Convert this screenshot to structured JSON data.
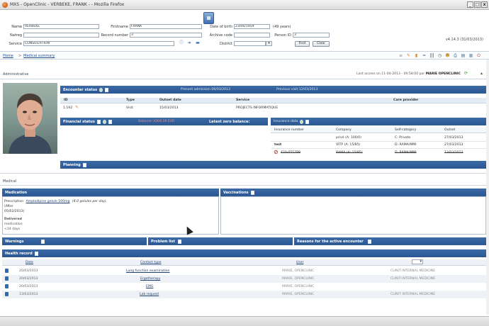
{
  "window": {
    "title": "MXS - OpenClinic - VERBEKE, FRANK - - Mozilla Firefox"
  },
  "patient": {
    "name_label": "Name",
    "name_value": "VERBEKE",
    "firstname_label": "Firstname",
    "firstname_value": "FRANK",
    "dob_label": "Date of birth",
    "dob_value": "23/06/1959",
    "age": "(49 years)",
    "natreg_label": "Natreg",
    "natreg_value": "",
    "record_label": "Record number",
    "record_value": "3",
    "archive_label": "Archive code",
    "archive_value": "",
    "person_label": "Person ID",
    "person_value": "3",
    "service_label": "Service",
    "service_value": "CONSULTATION",
    "district_label": "District",
    "district_value": ""
  },
  "buttons": {
    "find": "Find",
    "clear": "Clear"
  },
  "version": "v4.14.3 (31/03/2013)",
  "nav": {
    "home": "Home",
    "sep": ">",
    "summary": "Medical summary"
  },
  "administrative": {
    "title": "Administrative",
    "last_access_text": "Last access on 11-04-2013 - 09:58:00 par",
    "last_access_user": "MARIE OPENCLINIC"
  },
  "encounter": {
    "title": "Encounter status",
    "info_active": "Present admission 06/03/2013",
    "info_previous": "Previous visit 12/03/2013",
    "columns": [
      "ID",
      "Type",
      "Outset date",
      "Service",
      "Care provider"
    ],
    "rows": [
      {
        "id": "1.192",
        "type": "Visit",
        "date": "15/03/2013",
        "service": "PROJECTS INFORMATIQUE",
        "provider": ""
      }
    ]
  },
  "financial": {
    "title": "Financial status",
    "balance": "Balance: 4304,16 EUR",
    "last_zero": "Latest zero balance:"
  },
  "insurance": {
    "title": "Insurance data",
    "columns": [
      "Insurance number",
      "Company",
      "Self-category",
      "Outset"
    ],
    "rows": [
      {
        "number": "",
        "company": "privé (A: 100/0)",
        "category": "C: Privato",
        "outset": "27/03/2013"
      },
      {
        "number": "test",
        "company": "VITP (A: 15/85)",
        "category": "D: RAMA/MMI",
        "outset": "27/03/2013"
      },
      {
        "number": "420-055789",
        "company": "RAMA (A: 15/85)",
        "category": "D: RAMA/MMI",
        "outset": "13/03/2013"
      }
    ]
  },
  "planning": {
    "title": "Planning"
  },
  "medical": {
    "title": "Medical"
  },
  "medication": {
    "title": "Medication",
    "prescription_label": "Prescription",
    "drug": "Amplodipine gelule 500mg",
    "dosage": "(4.0 gelules per day)",
    "after_label": "(After",
    "after_date": "05/02/2013)",
    "delivered_label": "Delivered",
    "delivered_sub": "medication",
    "delivered_days": "<14 days"
  },
  "vaccinations": {
    "title": "Vaccinations"
  },
  "warnings": {
    "title": "Warnings"
  },
  "problem_list": {
    "title": "Problem list"
  },
  "reasons": {
    "title": "Reasons for the active encounter"
  },
  "health_record": {
    "title": "Health record",
    "columns": [
      "Date",
      "Contact type",
      "User",
      ""
    ],
    "rows": [
      {
        "date": "20/03/2013",
        "contact": "Lung function examination",
        "user": "MARIE, OPENCLINIC",
        "service": "CLINIT INTERNAL MEDICINE"
      },
      {
        "date": "20/03/2013",
        "contact": "Ergotherapy",
        "user": "MARIE, OPENCLINIC",
        "service": "CLINIT INTERNAL MEDICINE"
      },
      {
        "date": "20/03/2013",
        "contact": "EMG",
        "user": "MARIE, OPENCLINIC",
        "service": ""
      },
      {
        "date": "13/03/2013",
        "contact": "Lab request",
        "user": "MARIE, OPENCLINIC",
        "service": "CLINIT INTERNAL MEDICINE"
      }
    ]
  }
}
